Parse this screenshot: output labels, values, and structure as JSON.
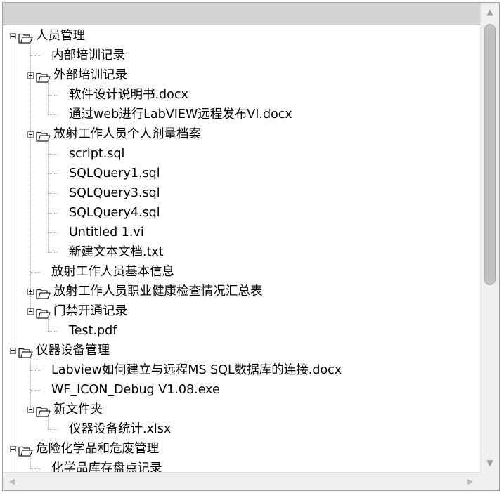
{
  "tree": {
    "rows": [
      {
        "label": "人员管理",
        "level": 0,
        "expander": "expanded",
        "icon": "folder-open-icon"
      },
      {
        "label": "内部培训记录",
        "level": 1,
        "expander": "none",
        "icon": "none"
      },
      {
        "label": "外部培训记录",
        "level": 1,
        "expander": "expanded",
        "icon": "folder-open-icon"
      },
      {
        "label": "软件设计说明书.docx",
        "level": 2,
        "expander": "none",
        "icon": "none"
      },
      {
        "label": "通过web进行LabVIEW远程发布VI.docx",
        "level": 2,
        "expander": "none",
        "icon": "none"
      },
      {
        "label": "放射工作人员个人剂量档案",
        "level": 1,
        "expander": "expanded",
        "icon": "folder-open-icon"
      },
      {
        "label": "script.sql",
        "level": 2,
        "expander": "none",
        "icon": "none"
      },
      {
        "label": "SQLQuery1.sql",
        "level": 2,
        "expander": "none",
        "icon": "none"
      },
      {
        "label": "SQLQuery3.sql",
        "level": 2,
        "expander": "none",
        "icon": "none"
      },
      {
        "label": "SQLQuery4.sql",
        "level": 2,
        "expander": "none",
        "icon": "none"
      },
      {
        "label": "Untitled 1.vi",
        "level": 2,
        "expander": "none",
        "icon": "none"
      },
      {
        "label": "新建文本文档.txt",
        "level": 2,
        "expander": "none",
        "icon": "none"
      },
      {
        "label": "放射工作人员基本信息",
        "level": 1,
        "expander": "none",
        "icon": "none"
      },
      {
        "label": "放射工作人员职业健康检查情况汇总表",
        "level": 1,
        "expander": "collapsed",
        "icon": "folder-open-icon"
      },
      {
        "label": "门禁开通记录",
        "level": 1,
        "expander": "expanded",
        "icon": "folder-open-icon"
      },
      {
        "label": "Test.pdf",
        "level": 2,
        "expander": "none",
        "icon": "none"
      },
      {
        "label": "仪器设备管理",
        "level": 0,
        "expander": "expanded",
        "icon": "folder-open-icon"
      },
      {
        "label": "Labview如何建立与远程MS SQL数据库的连接.docx",
        "level": 1,
        "expander": "none",
        "icon": "none"
      },
      {
        "label": "WF_ICON_Debug V1.08.exe",
        "level": 1,
        "expander": "none",
        "icon": "none"
      },
      {
        "label": "新文件夹",
        "level": 1,
        "expander": "expanded",
        "icon": "folder-open-icon"
      },
      {
        "label": "仪器设备统计.xlsx",
        "level": 2,
        "expander": "none",
        "icon": "none"
      },
      {
        "label": "危险化学品和危废管理",
        "level": 0,
        "expander": "expanded",
        "icon": "folder-open-icon"
      },
      {
        "label": "化学品库存盘点记录",
        "level": 1,
        "expander": "none",
        "icon": "none"
      }
    ]
  },
  "scrollbars": {
    "up_icon": "scroll-up-arrow-icon",
    "down_icon": "scroll-down-arrow-icon",
    "left_icon": "scroll-left-arrow-icon",
    "right_icon": "scroll-right-arrow-icon",
    "vertical_thumb_position": 0.0
  },
  "colors": {
    "header": "#d4d4d4",
    "connector": "#a8a8a8",
    "scroll_thumb": "#c1c1c1",
    "text": "#000000"
  }
}
